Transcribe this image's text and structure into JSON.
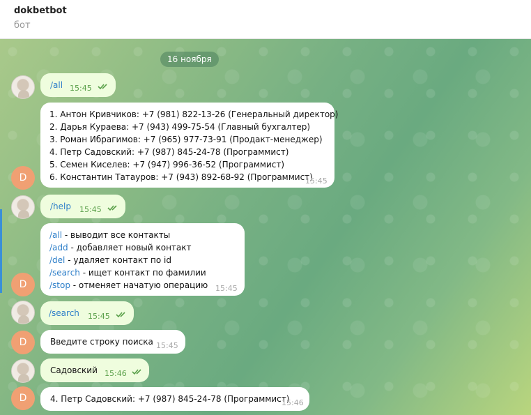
{
  "header": {
    "title": "dokbetbot",
    "status": "бот"
  },
  "date_separator": "16 ноября",
  "colors": {
    "outgoing_bubble": "#effdde",
    "incoming_bubble": "#ffffff",
    "command_link": "#2e7fc9",
    "read_ticks": "#5aa04a",
    "bot_avatar": "#f0a073"
  },
  "avatar_letter": "D",
  "messages": {
    "m1": {
      "text": "/all",
      "time": "15:45"
    },
    "m2": {
      "lines": [
        "1. Антон Кривчиков: +7 (981) 822-13-26 (Генеральный директор)",
        "2. Дарья Кураева: +7 (943) 499-75-54 (Главный бухгалтер)",
        "3. Роман Ибрагимов: +7 (965) 977-73-91 (Продакт-менеджер)",
        "4. Петр Садовский: +7 (987) 845-24-78 (Программист)",
        "5. Семен Киселев: +7 (947) 996-36-52 (Программист)",
        "6. Константин Татауров: +7 (943) 892-68-92 (Программист)"
      ],
      "time": "15:45"
    },
    "m3": {
      "text": "/help",
      "time": "15:45"
    },
    "m4": {
      "lines": [
        {
          "cmd": "/all",
          "desc": " - выводит все контакты"
        },
        {
          "cmd": "/add",
          "desc": " - добавляет новый контакт"
        },
        {
          "cmd": "/del",
          "desc": " - удаляет контакт по id"
        },
        {
          "cmd": "/search",
          "desc": " - ищет контакт по фамилии"
        },
        {
          "cmd": "/stop",
          "desc": " - отменяет начатую операцию"
        }
      ],
      "time": "15:45"
    },
    "m5": {
      "text": "/search",
      "time": "15:45"
    },
    "m6": {
      "text": "Введите строку поиска",
      "time": "15:45"
    },
    "m7": {
      "text": "Садовский",
      "time": "15:46"
    },
    "m8": {
      "text": "4. Петр Садовский: +7 (987) 845-24-78 (Программист)",
      "time": "15:46"
    }
  }
}
